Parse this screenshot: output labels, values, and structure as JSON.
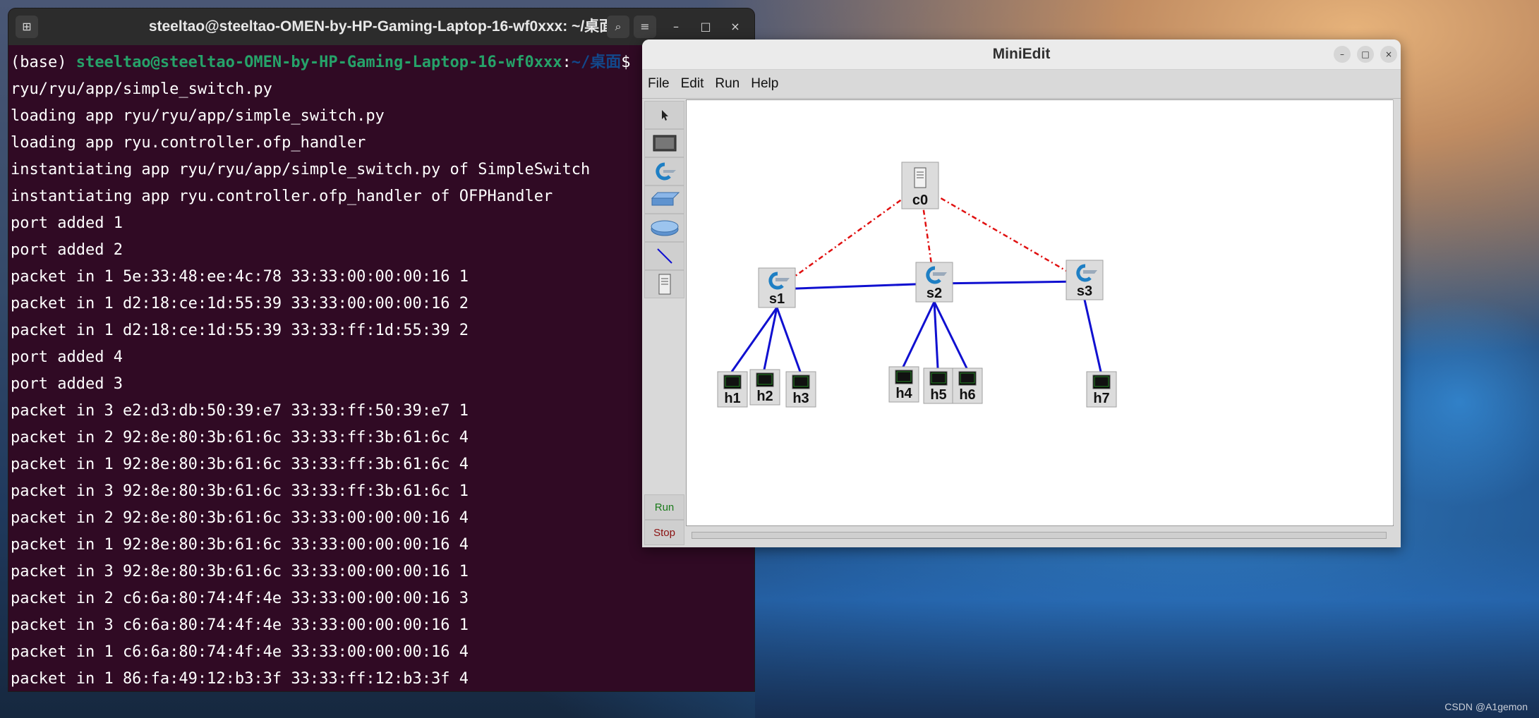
{
  "terminal": {
    "title": "steeltao@steeltao-OMEN-by-HP-Gaming-Laptop-16-wf0xxx: ~/桌面",
    "prompt_prefix": "(base) ",
    "prompt_user": "steeltao@steeltao-OMEN-by-HP-Gaming-Laptop-16-wf0xxx",
    "prompt_colon": ":",
    "prompt_path": "~/桌面",
    "prompt_suffix": "$ r",
    "lines": [
      "ryu/ryu/app/simple_switch.py",
      "loading app ryu/ryu/app/simple_switch.py",
      "loading app ryu.controller.ofp_handler",
      "instantiating app ryu/ryu/app/simple_switch.py of SimpleSwitch",
      "instantiating app ryu.controller.ofp_handler of OFPHandler",
      "port added 1",
      "port added 2",
      "packet in 1 5e:33:48:ee:4c:78 33:33:00:00:00:16 1",
      "packet in 1 d2:18:ce:1d:55:39 33:33:00:00:00:16 2",
      "packet in 1 d2:18:ce:1d:55:39 33:33:ff:1d:55:39 2",
      "port added 4",
      "port added 3",
      "packet in 3 e2:d3:db:50:39:e7 33:33:ff:50:39:e7 1",
      "packet in 2 92:8e:80:3b:61:6c 33:33:ff:3b:61:6c 4",
      "packet in 1 92:8e:80:3b:61:6c 33:33:ff:3b:61:6c 4",
      "packet in 3 92:8e:80:3b:61:6c 33:33:ff:3b:61:6c 1",
      "packet in 2 92:8e:80:3b:61:6c 33:33:00:00:00:16 4",
      "packet in 1 92:8e:80:3b:61:6c 33:33:00:00:00:16 4",
      "packet in 3 92:8e:80:3b:61:6c 33:33:00:00:00:16 1",
      "packet in 2 c6:6a:80:74:4f:4e 33:33:00:00:00:16 3",
      "packet in 3 c6:6a:80:74:4f:4e 33:33:00:00:00:16 1",
      "packet in 1 c6:6a:80:74:4f:4e 33:33:00:00:00:16 4",
      "packet in 1 86:fa:49:12:b3:3f 33:33:ff:12:b3:3f 4"
    ]
  },
  "miniedit": {
    "title": "MiniEdit",
    "menu": [
      "File",
      "Edit",
      "Run",
      "Help"
    ],
    "run_label": "Run",
    "stop_label": "Stop",
    "tools": [
      "select-tool",
      "host-tool",
      "switch-tool",
      "legacy-switch-tool",
      "legacy-router-tool",
      "link-tool",
      "controller-tool"
    ],
    "nodes": [
      {
        "id": "c0",
        "label": "c0",
        "kind": "controller"
      },
      {
        "id": "s1",
        "label": "s1",
        "kind": "switch"
      },
      {
        "id": "s2",
        "label": "s2",
        "kind": "switch"
      },
      {
        "id": "s3",
        "label": "s3",
        "kind": "switch"
      },
      {
        "id": "h1",
        "label": "h1",
        "kind": "host"
      },
      {
        "id": "h2",
        "label": "h2",
        "kind": "host"
      },
      {
        "id": "h3",
        "label": "h3",
        "kind": "host"
      },
      {
        "id": "h4",
        "label": "h4",
        "kind": "host"
      },
      {
        "id": "h5",
        "label": "h5",
        "kind": "host"
      },
      {
        "id": "h6",
        "label": "h6",
        "kind": "host"
      },
      {
        "id": "h7",
        "label": "h7",
        "kind": "host"
      }
    ],
    "controller_links": [
      [
        "c0",
        "s1"
      ],
      [
        "c0",
        "s2"
      ],
      [
        "c0",
        "s3"
      ]
    ],
    "data_links": [
      [
        "s1",
        "s2"
      ],
      [
        "s2",
        "s3"
      ],
      [
        "s1",
        "h1"
      ],
      [
        "s1",
        "h2"
      ],
      [
        "s1",
        "h3"
      ],
      [
        "s2",
        "h4"
      ],
      [
        "s2",
        "h5"
      ],
      [
        "s2",
        "h6"
      ],
      [
        "s3",
        "h7"
      ]
    ],
    "colors": {
      "controller_link": "#e01010",
      "data_link": "#1010d0",
      "run": "#1a7a1a",
      "stop": "#8a1010"
    }
  },
  "watermark": "CSDN @A1gemon"
}
